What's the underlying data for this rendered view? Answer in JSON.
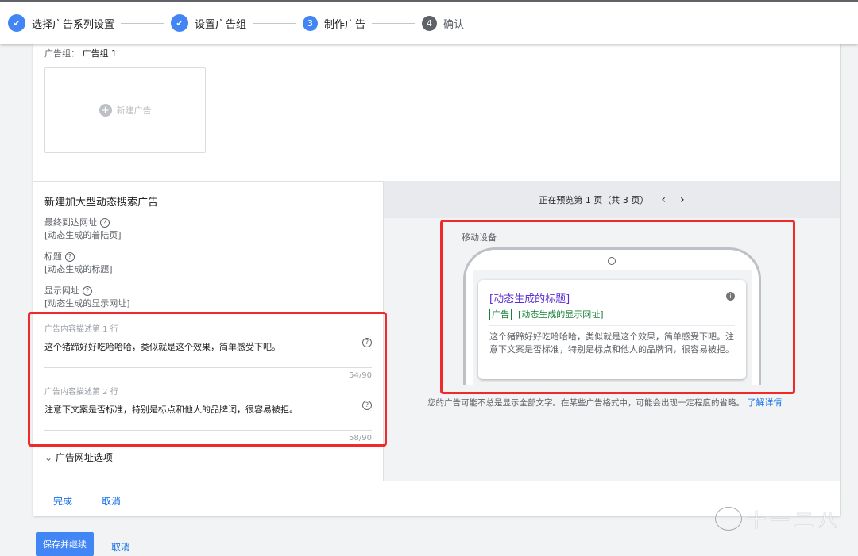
{
  "steps": [
    {
      "label": "选择广告系列设置",
      "state": "done"
    },
    {
      "label": "设置广告组",
      "state": "done"
    },
    {
      "number": "3",
      "label": "制作广告",
      "state": "active"
    },
    {
      "number": "4",
      "label": "确认",
      "state": "pending"
    }
  ],
  "ad_group": {
    "label": "广告组：",
    "value": "广告组 1"
  },
  "new_ad": "新建广告",
  "form": {
    "title": "新建加大型动态搜索广告",
    "fields": [
      {
        "label": "最终到达网址",
        "value": "[动态生成的着陆页]"
      },
      {
        "label": "标题",
        "value": "[动态生成的标题]"
      },
      {
        "label": "显示网址",
        "value": "[动态生成的显示网址]"
      }
    ],
    "desc1": {
      "label": "广告内容描述第 1 行",
      "value": "这个猪蹄好好吃哈哈哈，类似就是这个效果，简单感受下吧。",
      "count": "54/90"
    },
    "desc2": {
      "label": "广告内容描述第 2 行",
      "value": "注意下文案是否标准，特别是标点和他人的品牌词，很容易被拒。",
      "count": "58/90"
    },
    "url_options": "广告网址选项"
  },
  "preview": {
    "pager": "正在预览第 1 页（共 3 页）",
    "device": "移动设备",
    "headline": "[动态生成的标题]",
    "badge": "广告",
    "display_url": "[动态生成的显示网址]",
    "body": "这个猪蹄好好吃哈哈哈，类似就是这个效果，简单感受下吧。注意下文案是否标准，特别是标点和他人的品牌词，很容易被拒。",
    "note": "您的广告可能不总是显示全部文字。在某些广告格式中，可能会出现一定程度的省略。",
    "learn_more": "了解详情"
  },
  "footer": {
    "done": "完成",
    "cancel": "取消"
  },
  "bottom": {
    "save": "保存并继续",
    "cancel": "取消"
  },
  "watermark": "十一二八"
}
